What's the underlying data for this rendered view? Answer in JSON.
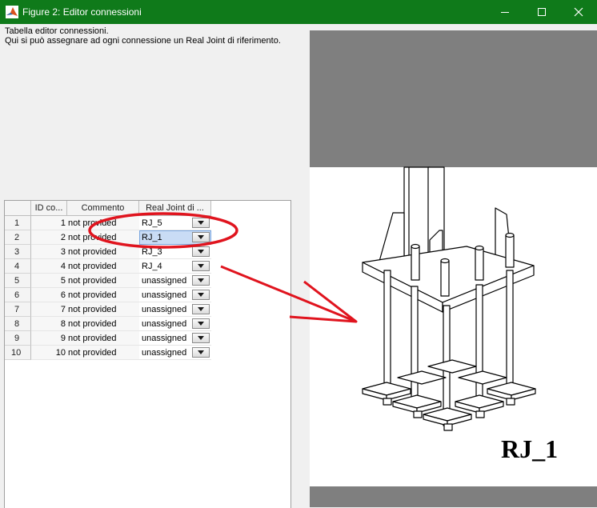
{
  "window": {
    "title": "Figure 2: Editor connessioni",
    "icon": "matlab-icon",
    "controls": [
      "minimize-icon",
      "maximize-icon",
      "close-icon"
    ]
  },
  "description": {
    "line1": "Tabella editor connessioni.",
    "line2": "Qui si può assegnare ad ogni connessione un Real Joint di riferimento."
  },
  "table": {
    "headers": [
      "ID co...",
      "Commento",
      "Real Joint di ..."
    ],
    "rows": [
      {
        "num": "1",
        "id": "1",
        "comment": "not provided",
        "rj": "RJ_5"
      },
      {
        "num": "2",
        "id": "2",
        "comment": "not provided",
        "rj": "RJ_1"
      },
      {
        "num": "3",
        "id": "3",
        "comment": "not provided",
        "rj": "RJ_3"
      },
      {
        "num": "4",
        "id": "4",
        "comment": "not provided",
        "rj": "RJ_4"
      },
      {
        "num": "5",
        "id": "5",
        "comment": "not provided",
        "rj": "unassigned"
      },
      {
        "num": "6",
        "id": "6",
        "comment": "not provided",
        "rj": "unassigned"
      },
      {
        "num": "7",
        "id": "7",
        "comment": "not provided",
        "rj": "unassigned"
      },
      {
        "num": "8",
        "id": "8",
        "comment": "not provided",
        "rj": "unassigned"
      },
      {
        "num": "9",
        "id": "9",
        "comment": "not provided",
        "rj": "unassigned"
      },
      {
        "num": "10",
        "id": "10",
        "comment": "not provided",
        "rj": "unassigned"
      }
    ],
    "selected_row": 2
  },
  "preview": {
    "label": "RJ_1"
  },
  "colors": {
    "titlebar": "#0f7a1a",
    "annotation": "#e0141e",
    "preview_band": "#7f7f7f",
    "selection": "#c9dcf5"
  }
}
